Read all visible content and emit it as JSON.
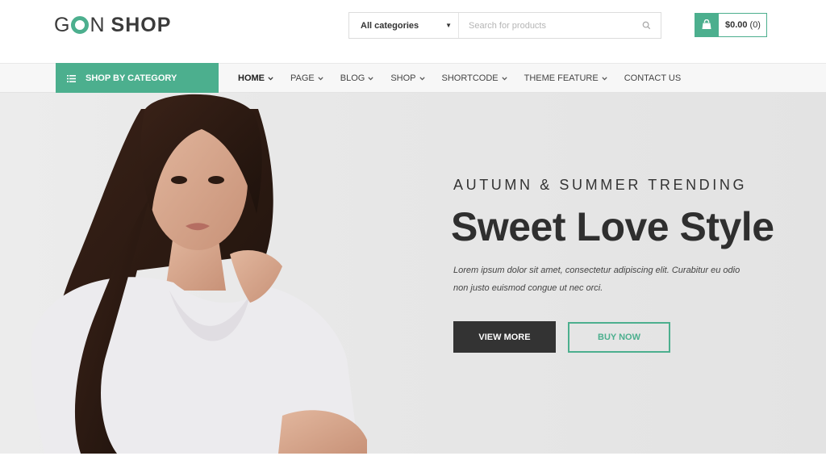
{
  "logo": {
    "part1": "G",
    "part2": "N",
    "part3": "SHOP"
  },
  "search": {
    "category": "All categories",
    "placeholder": "Search for products"
  },
  "cart": {
    "total": "$0.00",
    "count": "(0)"
  },
  "nav": {
    "category_button": "SHOP BY CATEGORY",
    "items": [
      {
        "label": "HOME",
        "active": true,
        "dropdown": true
      },
      {
        "label": "PAGE",
        "dropdown": true
      },
      {
        "label": "BLOG",
        "dropdown": true
      },
      {
        "label": "SHOP",
        "dropdown": true
      },
      {
        "label": "SHORTCODE",
        "dropdown": true
      },
      {
        "label": "THEME FEATURE",
        "dropdown": true
      },
      {
        "label": "CONTACT US",
        "dropdown": false
      }
    ]
  },
  "hero": {
    "kicker": "AUTUMN & SUMMER TRENDING",
    "headline": "Sweet Love Style",
    "description": "Lorem ipsum dolor sit amet, consectetur adipiscing elit. Curabitur eu odio non justo euismod congue ut nec orci.",
    "primary_button": "VIEW MORE",
    "secondary_button": "BUY NOW"
  },
  "colors": {
    "accent": "#4caf8e",
    "dark": "#333333",
    "hero_bg": "#e7e7e7"
  }
}
